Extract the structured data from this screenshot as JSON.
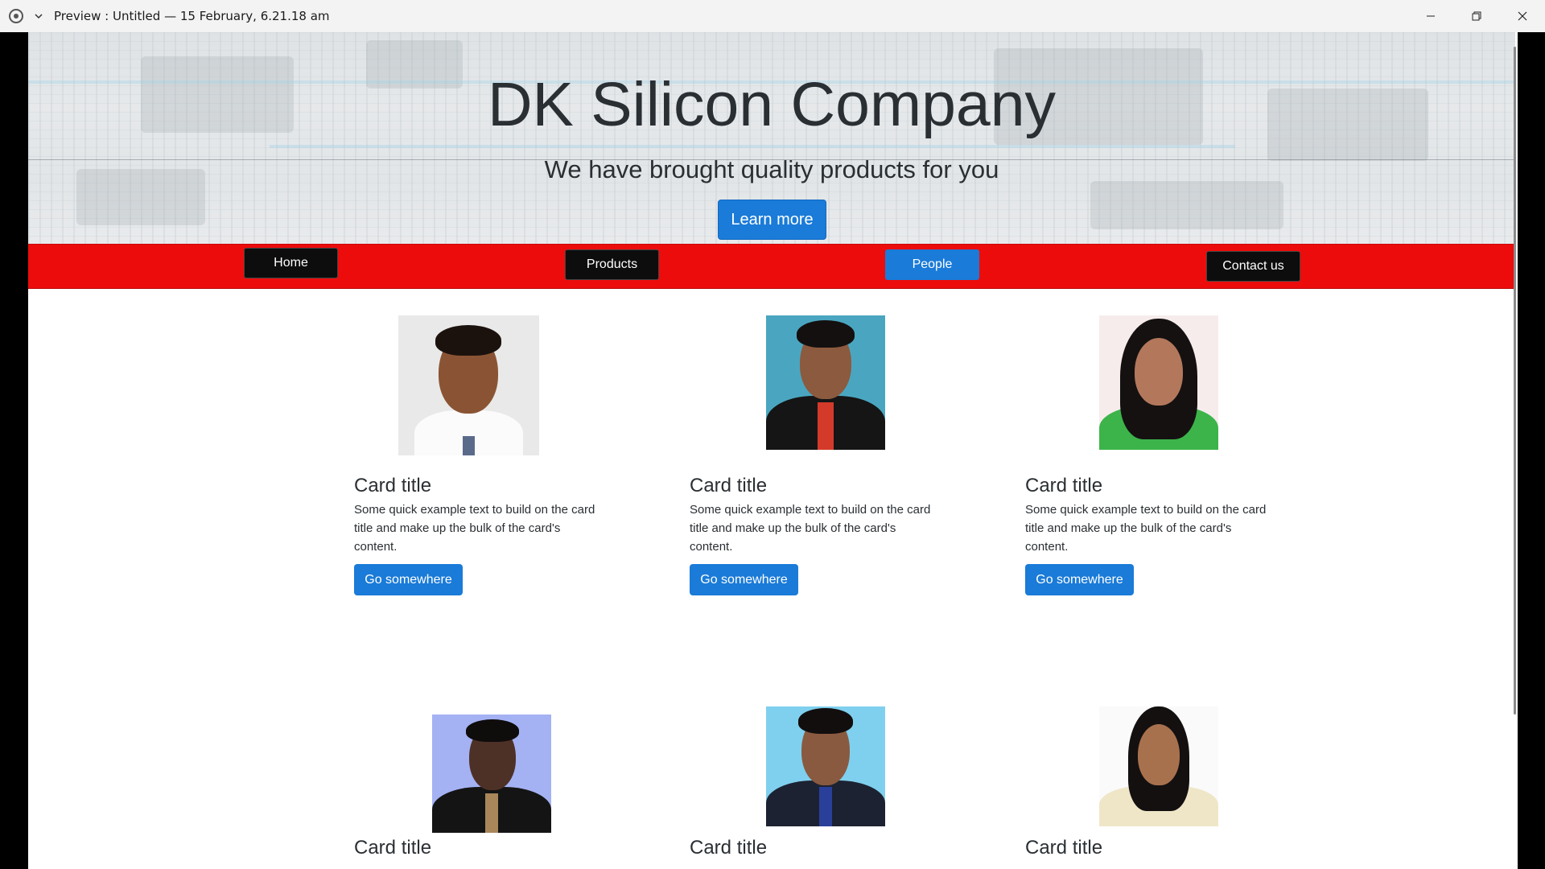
{
  "window": {
    "title": "Preview : Untitled — 15 February, 6.21.18 am"
  },
  "hero": {
    "title": "DK Silicon Company",
    "subtitle": "We have brought quality products for you",
    "button_label": "Learn more"
  },
  "nav": {
    "items": [
      {
        "label": "Home",
        "active": false
      },
      {
        "label": "Products",
        "active": false
      },
      {
        "label": "People",
        "active": true
      },
      {
        "label": "Contact us",
        "active": false
      }
    ]
  },
  "cards": [
    {
      "title": "Card title",
      "text": "Some quick example text to build on the card title and make up the bulk of the card's content.",
      "button": "Go somewhere"
    },
    {
      "title": "Card title",
      "text": "Some quick example text to build on the card title and make up the bulk of the card's content.",
      "button": "Go somewhere"
    },
    {
      "title": "Card title",
      "text": "Some quick example text to build on the card title and make up the bulk of the card's content.",
      "button": "Go somewhere"
    },
    {
      "title": "Card title"
    },
    {
      "title": "Card title"
    },
    {
      "title": "Card title"
    }
  ],
  "colors": {
    "primary": "#1a7bd8",
    "navbar": "#ec0c0c",
    "nav_button": "#0d0d0d"
  },
  "icons": {
    "app": "record-icon",
    "dropdown": "chevron-down-icon",
    "minimize": "minimize-icon",
    "restore": "restore-icon",
    "close": "close-icon"
  }
}
